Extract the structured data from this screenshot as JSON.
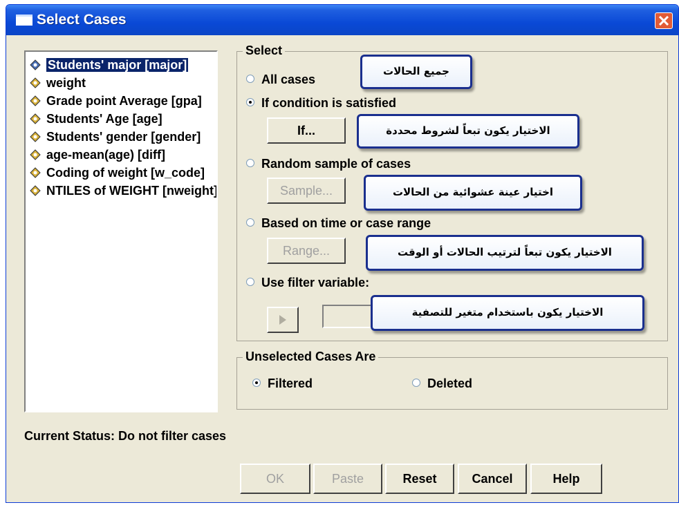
{
  "window": {
    "title": "Select Cases"
  },
  "variables": [
    {
      "label": "Students' major [major]",
      "selected": true
    },
    {
      "label": "weight"
    },
    {
      "label": "Grade point Average [gpa]"
    },
    {
      "label": "Students' Age [age]"
    },
    {
      "label": "Students' gender [gender]"
    },
    {
      "label": "age-mean(age) [diff]"
    },
    {
      "label": "Coding of weight [w_code]"
    },
    {
      "label": "NTILES of WEIGHT [nweight]"
    }
  ],
  "select": {
    "title": "Select",
    "options": {
      "all": "All cases",
      "condition": "If condition is satisfied",
      "random": "Random sample of cases",
      "time": "Based on time or case range",
      "filter": "Use filter variable:"
    },
    "selected": "condition",
    "if_button": "If...",
    "sample_button": "Sample...",
    "range_button": "Range..."
  },
  "callouts": {
    "all": "جميع الحالات",
    "condition": "الاختيار يكون تبعاً لشروط محددة",
    "random": "اختيار عينة عشوائية من الحالات",
    "time": "الاختيار يكون تبعاً لترتيب الحالات أو الوقت",
    "filter": "الاختيار يكون باستخدام متغير للتصفية"
  },
  "unselected": {
    "title": "Unselected Cases Are",
    "filtered": "Filtered",
    "deleted": "Deleted",
    "selected": "filtered"
  },
  "status": "Current Status: Do not filter cases",
  "buttons": {
    "ok": "OK",
    "paste": "Paste",
    "reset": "Reset",
    "cancel": "Cancel",
    "help": "Help"
  },
  "colors": {
    "titlebar": "#0a49d6",
    "selection": "#0a246a",
    "dialog": "#ece9d8",
    "callout_border": "#1a2f8e"
  }
}
